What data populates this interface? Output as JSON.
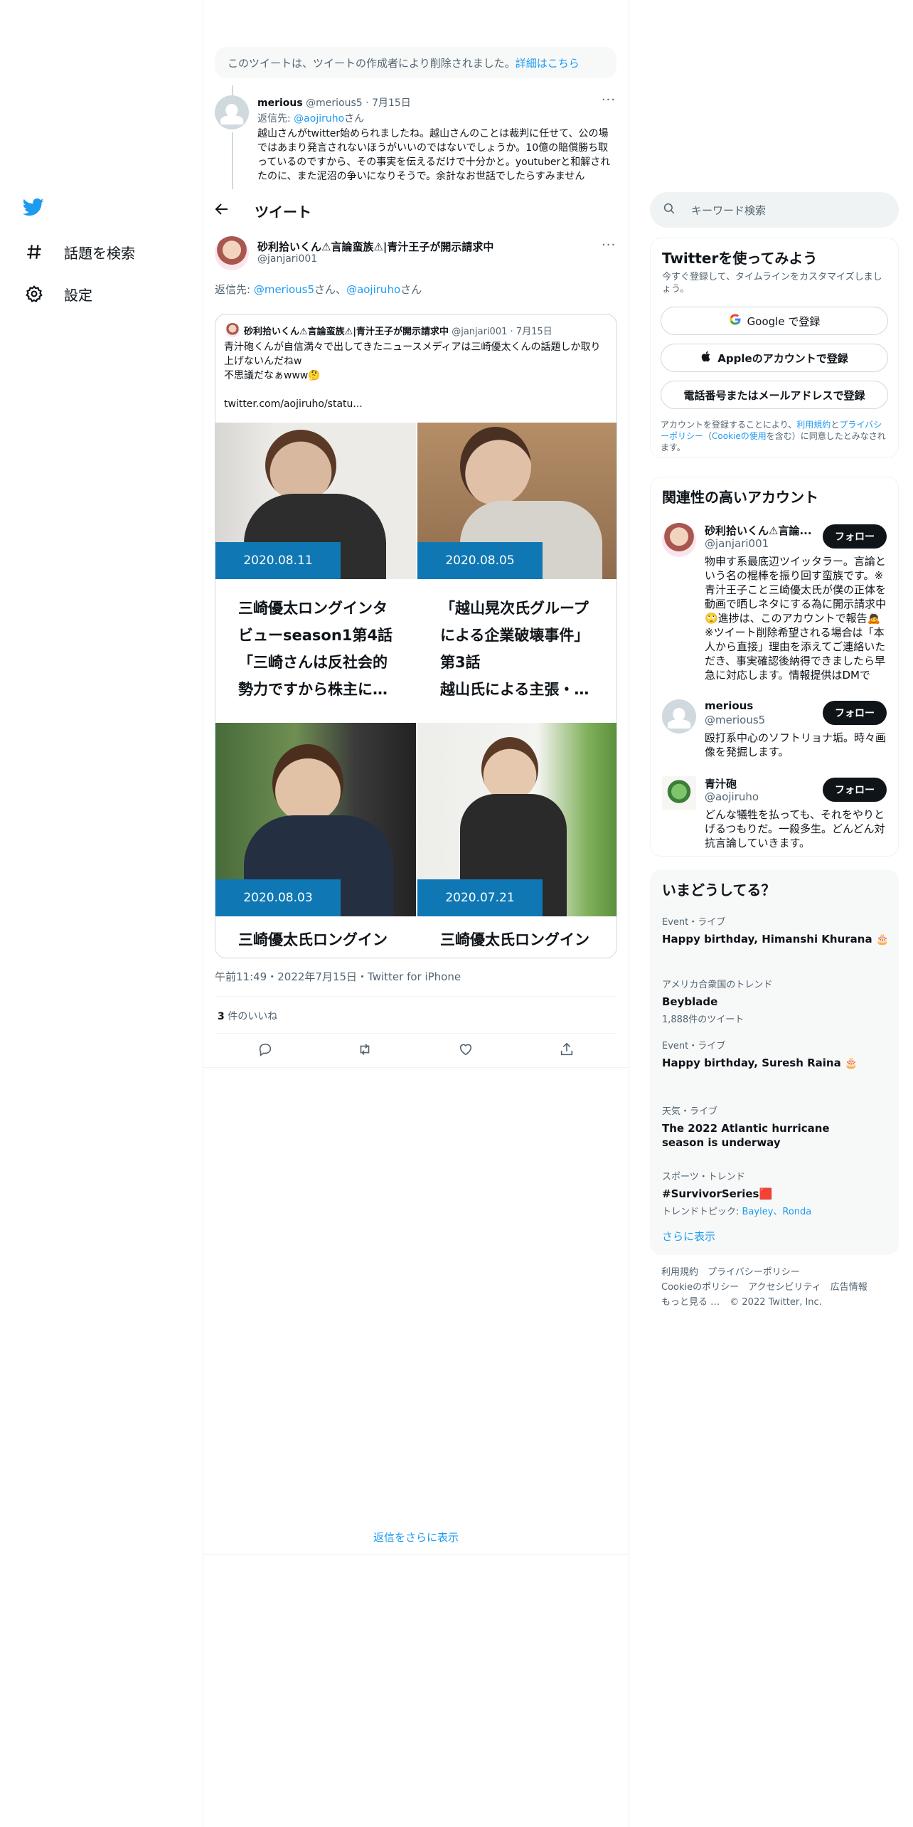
{
  "nav": {
    "explore_label": "話題を検索",
    "settings_label": "設定"
  },
  "deleted_notice": {
    "text": "このツイートは、ツイートの作成者により削除されました。",
    "link": "詳細はこちら"
  },
  "reply_tweet": {
    "name": "merious",
    "handle": "@merious5",
    "date": "7月15日",
    "replying_prefix": "返信先: ",
    "replying_to": "@aojiruho",
    "replying_suffix": "さん",
    "text": "越山さんがtwitter始められましたね。越山さんのことは裁判に任せて、公の場ではあまり発言されないほうがいいのではないでしょうか。10億の賠償勝ち取っているのですから、その事実を伝えるだけで十分かと。youtuberと和解されたのに、また泥沼の争いになりそうで。余計なお世話でしたらすみません"
  },
  "header": {
    "title": "ツイート"
  },
  "main_tweet": {
    "name": "砂利拾いくん⚠言論蛮族⚠|青汁王子が開示請求中",
    "handle": "@janjari001",
    "replying_prefix": "返信先: ",
    "replying_to_1": "@merious5",
    "replying_mid": "さん、",
    "replying_to_2": "@aojiruho",
    "replying_suffix": "さん",
    "timestamp": "午前11:49・2022年7月15日・Twitter for iPhone",
    "likes_count": "3",
    "likes_label": "件のいいね"
  },
  "quote": {
    "name": "砂利拾いくん⚠言論蛮族⚠|青汁王子が開示請求中",
    "handle": "@janjari001",
    "date": "7月15日",
    "line1": "青汁砲くんが自信満々で出してきたニュースメディアは三崎優太くんの話題しか取り上げないんだねw",
    "line2": "不思議だなぁwww🤔",
    "link": "twitter.com/aojiruho/statu...",
    "cards": [
      {
        "date": "2020.08.11",
        "title": "三崎優太ロングインタビューseason1第4話「三崎さんは反社会的勢力ですから株主に…"
      },
      {
        "date": "2020.08.05",
        "title": "「越山晃次氏グループによる企業破壊事件」第3話\n越山氏による主張・…"
      },
      {
        "date": "2020.08.03",
        "title": "三崎優太氏ロングイン"
      },
      {
        "date": "2020.07.21",
        "title": "三崎優太氏ロングイン"
      }
    ]
  },
  "show_more_replies": "返信をさらに表示",
  "search": {
    "placeholder": "キーワード検索"
  },
  "signup": {
    "title": "Twitterを使ってみよう",
    "subtitle": "今すぐ登録して、タイムラインをカスタマイズしましょう。",
    "google": "Google で登録",
    "apple": "Appleのアカウントで登録",
    "phone": "電話番号またはメールアドレスで登録",
    "terms_1": "アカウントを登録することにより、",
    "terms_link1": "利用規約",
    "terms_2": "と",
    "terms_link2": "プライバシーポリシー",
    "terms_3": "（",
    "terms_link3": "Cookieの使用",
    "terms_4": "を含む）に同意したとみなされます。"
  },
  "related": {
    "title": "関連性の高いアカウント",
    "follow_label": "フォロー",
    "accounts": [
      {
        "name": "砂利拾いくん⚠言論...",
        "handle": "@janjari001",
        "bio": "物申す系最底辺ツイッタラー。言論という名の棍棒を振り回す蛮族です。※青汁王子こと三崎優太氏が僕の正体を動画で晒しネタにする為に開示請求中🙄進捗は、このアカウントで報告🙇※ツイート削除希望される場合は「本人から直接」理由を添えてご連絡いただき、事実確認後納得できましたら早急に対応します。情報提供はDMで"
      },
      {
        "name": "merious",
        "handle": "@merious5",
        "bio": "殴打系中心のソフトリョナ垢。時々画像を発掘します。"
      },
      {
        "name": "青汁砲",
        "handle": "@aojiruho",
        "bio": "どんな犠牲を払っても、それをやりとげるつもりだ。一殺多生。どんどん対抗言論していきます。"
      }
    ]
  },
  "trends": {
    "title": "いまどうしてる？",
    "items": [
      {
        "category": "Event・ライブ",
        "name": "Happy birthday, Himanshi Khurana 🎂",
        "meta": ""
      },
      {
        "category": "アメリカ合衆国のトレンド",
        "name": "Beyblade",
        "meta": "1,888件のツイート"
      },
      {
        "category": "Event・ライブ",
        "name": "Happy birthday, Suresh Raina 🎂",
        "meta": ""
      },
      {
        "category": "天気・ライブ",
        "name": "The 2022 Atlantic hurricane season is underway",
        "meta": ""
      },
      {
        "category": "スポーツ・トレンド",
        "name": "#SurvivorSeries🟥",
        "meta_prefix": "トレンドトピック: ",
        "meta_links": "Bayley、Ronda"
      }
    ],
    "show_more": "さらに表示"
  },
  "footer": {
    "line1": "利用規約　プライバシーポリシー",
    "line2": "Cookieのポリシー　アクセシビリティ　広告情報",
    "more": "もっと見る …",
    "copyright": "© 2022 Twitter, Inc."
  },
  "colors": {
    "accent": "#1d9bf0",
    "date_badge": "#0f78b4",
    "text": "#0f1419",
    "muted": "#536471"
  }
}
